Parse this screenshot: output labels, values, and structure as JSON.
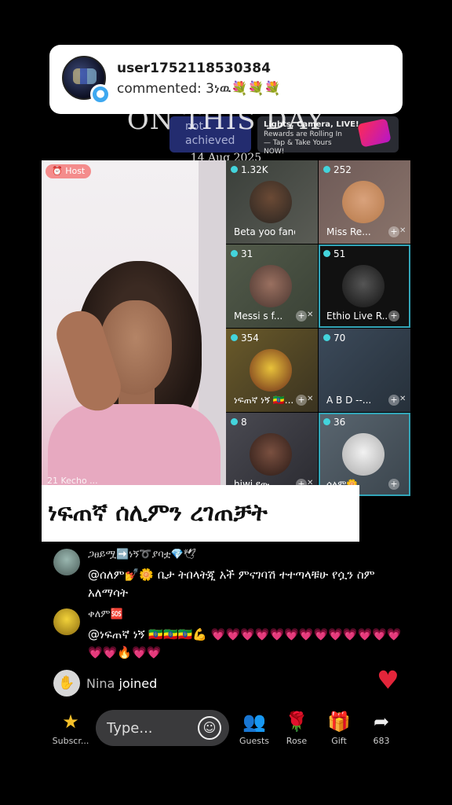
{
  "notification": {
    "username": "user1752118530384",
    "comment": "commented: 3ነዉ💐💐💐"
  },
  "overlay": {
    "status_text": "not achieved",
    "title": "ON THIS DAY",
    "date": "14 Aug 2025",
    "promo_line1": "Lights, Camera, LIVE!",
    "promo_line2": "Rewards are Rolling In — Tap & Take Yours NOW!"
  },
  "host": {
    "badge": "Host",
    "caption": "21 Kecho ..."
  },
  "guests": [
    {
      "count": "1.32K",
      "name": "Beta yoo fano ..."
    },
    {
      "count": "252",
      "name": "Miss Re..."
    },
    {
      "count": "31",
      "name": "Messi s f..."
    },
    {
      "count": "51",
      "name": "Ethio Live R..."
    },
    {
      "count": "354",
      "name": "ነፍጠኛ ነኝ 🇪🇹..."
    },
    {
      "count": "70",
      "name": "A B D --..."
    },
    {
      "count": "8",
      "name": "hiwi የው..."
    },
    {
      "count": "36",
      "name": "ሰለም🌼"
    }
  ],
  "caption_banner": "ነፍጠኛ ሰሊምን ረገጠቻት",
  "chat": [
    {
      "name": "ጋፀይሟ➡️ነኝ➰ያባቷ💎🕊",
      "text": "@ሰለም💅🌼 ቤታ ትበላትጂ አች ምናገባሽ ተተጣላቹሁ የሷን ስም አለማሳት"
    },
    {
      "name": "ቀለም🆘",
      "text": "@ነፍጠኛ ነኝ 🇪🇹🇪🇹🇪🇹💪 💗💗💗💗💗💗💗💗💗💗💗💗💗💗💗🔥💗💗"
    }
  ],
  "joined": {
    "name": "Nina",
    "text": "joined"
  },
  "bottom_bar": {
    "subscribe": "Subscr...",
    "type_placeholder": "Type...",
    "guests": "Guests",
    "rose": "Rose",
    "gift": "Gift",
    "share_count": "683"
  },
  "colors": {
    "accent_teal": "#43d4dc",
    "heart_red": "#e3253a",
    "host_badge": "#f48c8c"
  }
}
